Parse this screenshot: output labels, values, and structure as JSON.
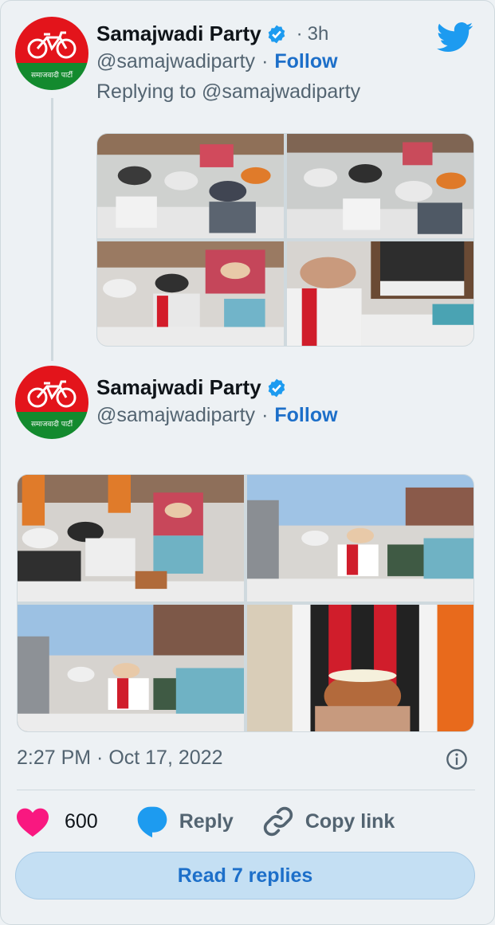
{
  "tweet1": {
    "name": "Samajwadi Party",
    "time": "3h",
    "handle": "@samajwadiparty",
    "follow_label": "Follow",
    "replying_to": "Replying to @samajwadiparty"
  },
  "tweet2": {
    "name": "Samajwadi Party",
    "handle": "@samajwadiparty",
    "follow_label": "Follow",
    "timestamp": "2:27 PM · Oct 17, 2022"
  },
  "avatar_text": "समाजवादी पार्टी",
  "separator": "·",
  "actions": {
    "like_count": "600",
    "reply_label": "Reply",
    "copy_link_label": "Copy link"
  },
  "read_replies_label": "Read 7 replies",
  "icons": [
    "twitter-bird-icon",
    "verified-badge-icon",
    "heart-icon",
    "reply-bubble-icon",
    "link-icon",
    "info-icon"
  ],
  "colors": {
    "accent": "#1d6fc9",
    "verified": "#1d9bf0",
    "like": "#f91880",
    "avatar_red": "#e3141b",
    "avatar_green": "#138a2e",
    "button_bg": "#c4dff3"
  }
}
